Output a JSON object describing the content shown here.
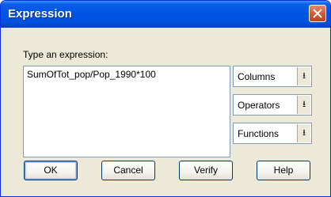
{
  "window": {
    "title": "Expression"
  },
  "dialog": {
    "prompt": "Type an expression:",
    "expression_value": "SumOfTot_pop/Pop_1990*100",
    "dropdowns": [
      {
        "label": "Columns",
        "arrow": "⭳"
      },
      {
        "label": "Operators",
        "arrow": "⭳"
      },
      {
        "label": "Functions",
        "arrow": "⭳"
      }
    ],
    "buttons": {
      "ok": "OK",
      "cancel": "Cancel",
      "verify": "Verify",
      "help": "Help"
    }
  },
  "colors": {
    "titlebar": "#0054e3",
    "close": "#d45a35",
    "face": "#ece9d8"
  }
}
